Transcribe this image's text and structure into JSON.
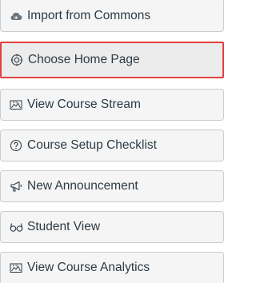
{
  "menu": {
    "items": [
      {
        "label": "Import from Commons",
        "icon": "cloud-import-icon"
      },
      {
        "label": "Choose Home Page",
        "icon": "target-icon"
      },
      {
        "label": "View Course Stream",
        "icon": "stream-icon"
      },
      {
        "label": "Course Setup Checklist",
        "icon": "question-circle-icon"
      },
      {
        "label": "New Announcement",
        "icon": "megaphone-icon"
      },
      {
        "label": "Student View",
        "icon": "glasses-icon"
      },
      {
        "label": "View Course Analytics",
        "icon": "analytics-icon"
      }
    ]
  },
  "colors": {
    "text": "#2d3b45",
    "button_bg": "#f5f5f5",
    "button_border": "#c7cdd1",
    "highlight_border": "#e0413d"
  }
}
